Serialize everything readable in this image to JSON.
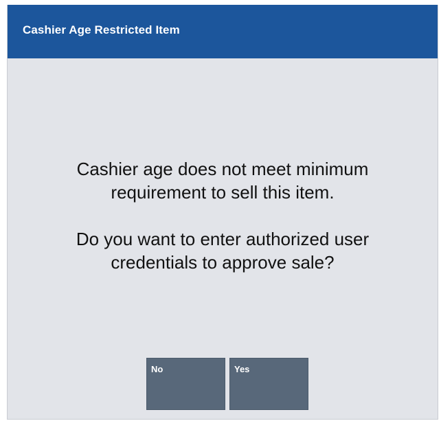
{
  "dialog": {
    "title": "Cashier Age Restricted Item",
    "message_line1": "Cashier age does not meet minimum",
    "message_line2": "requirement to sell this item.",
    "message_line3": "Do you want to enter authorized user",
    "message_line4": "credentials to approve sale?"
  },
  "buttons": {
    "no_label": "No",
    "yes_label": "Yes"
  },
  "colors": {
    "title_bar": "#1c569c",
    "background": "#e2e4e9",
    "button": "#58687a"
  }
}
